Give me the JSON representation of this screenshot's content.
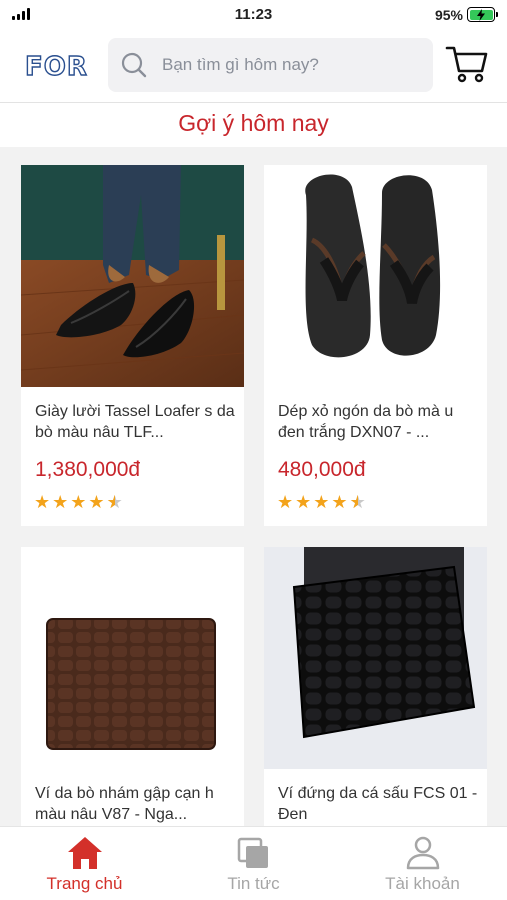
{
  "status_bar": {
    "time": "11:23",
    "battery_percent": "95%"
  },
  "header": {
    "logo": "FOR",
    "search": {
      "placeholder": "Bạn tìm gì hôm nay?"
    },
    "icons": {
      "search": "search-icon",
      "cart": "cart-icon"
    }
  },
  "section": {
    "title": "Gợi ý hôm nay"
  },
  "products": [
    {
      "name": "Giày lười Tassel Loafer s da bò màu nâu TLF...",
      "price": "1,380,000đ",
      "rating": 4.5
    },
    {
      "name": "Dép xỏ ngón da bò mà u đen trắng DXN07 - ...",
      "price": "480,000đ",
      "rating": 4.5
    },
    {
      "name": "Ví da bò nhám gập cạn h màu nâu V87 - Nga...",
      "price": "",
      "rating": null
    },
    {
      "name": "Ví đứng da cá sấu FCS 01 - Đen",
      "price": "",
      "rating": null
    }
  ],
  "bottom_nav": {
    "items": [
      {
        "label": "Trang chủ",
        "icon": "home-icon",
        "active": true
      },
      {
        "label": "Tin tức",
        "icon": "news-icon",
        "active": false
      },
      {
        "label": "Tài khoản",
        "icon": "user-icon",
        "active": false
      }
    ]
  },
  "colors": {
    "accent": "#d3302a",
    "logo": "#2a4f8f",
    "star": "#f3a31b",
    "battery": "#34c759"
  }
}
